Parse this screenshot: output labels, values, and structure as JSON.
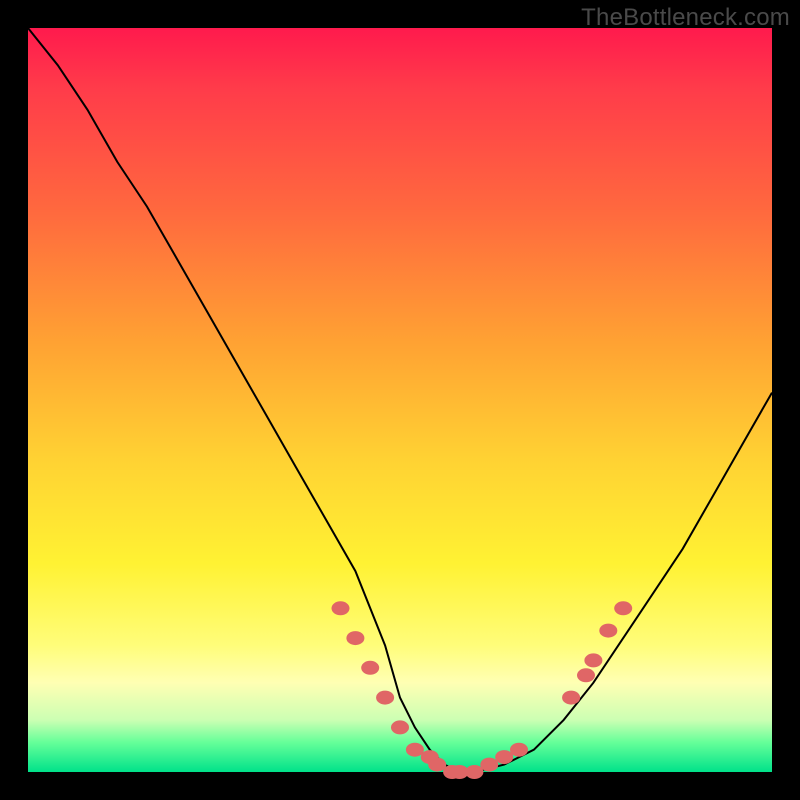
{
  "watermark": "TheBottleneck.com",
  "colors": {
    "background": "#000000",
    "gradient_top": "#ff1a4d",
    "gradient_mid": "#fff233",
    "gradient_bottom": "#00e28a",
    "curve": "#000000",
    "dots": "#e06666"
  },
  "chart_data": {
    "type": "line",
    "title": "",
    "xlabel": "",
    "ylabel": "",
    "xlim": [
      0,
      100
    ],
    "ylim": [
      0,
      100
    ],
    "series": [
      {
        "name": "bottleneck-curve",
        "x": [
          0,
          4,
          8,
          12,
          16,
          20,
          24,
          28,
          32,
          36,
          40,
          44,
          48,
          50,
          52,
          54,
          56,
          58,
          60,
          64,
          68,
          72,
          76,
          80,
          84,
          88,
          92,
          96,
          100
        ],
        "y": [
          100,
          95,
          89,
          82,
          76,
          69,
          62,
          55,
          48,
          41,
          34,
          27,
          17,
          10,
          6,
          3,
          1,
          0,
          0,
          1,
          3,
          7,
          12,
          18,
          24,
          30,
          37,
          44,
          51
        ]
      }
    ],
    "highlighted_points": {
      "name": "dots",
      "x": [
        42,
        44,
        46,
        48,
        50,
        52,
        54,
        55,
        57,
        58,
        60,
        62,
        64,
        66,
        73,
        75,
        76,
        78,
        80
      ],
      "y": [
        22,
        18,
        14,
        10,
        6,
        3,
        2,
        1,
        0,
        0,
        0,
        1,
        2,
        3,
        10,
        13,
        15,
        19,
        22
      ]
    }
  }
}
